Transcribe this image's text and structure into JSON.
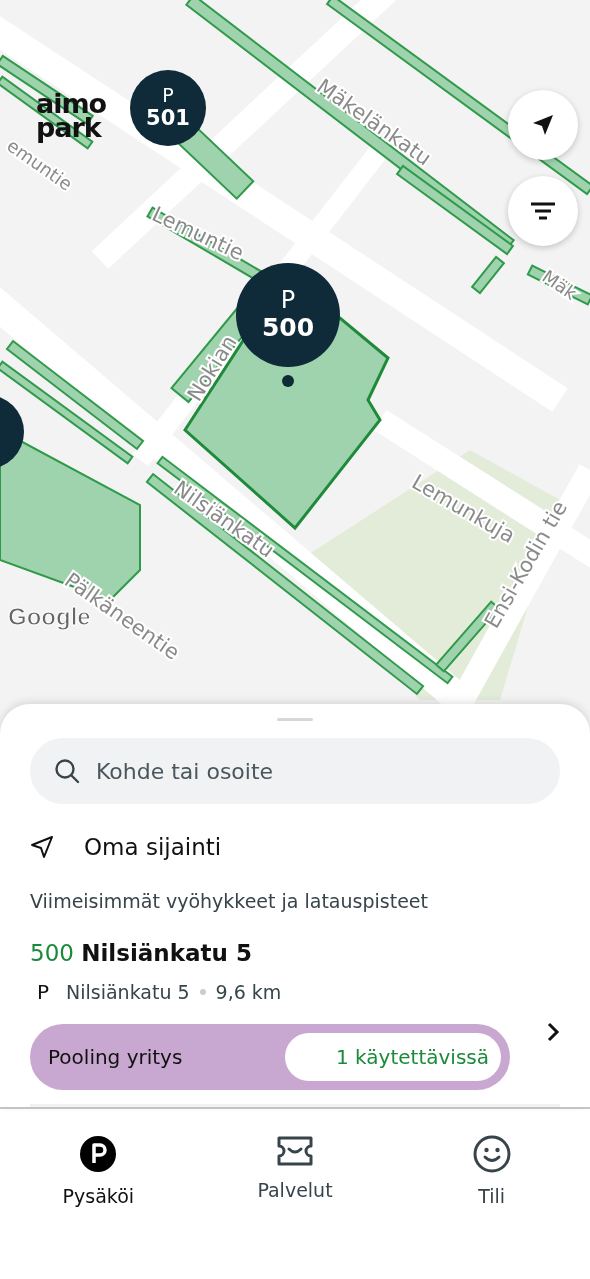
{
  "map": {
    "logo": {
      "line1": "aimo",
      "line2": "park"
    },
    "markers": [
      {
        "letter": "P",
        "number": "501"
      },
      {
        "letter": "P",
        "number": "500"
      }
    ],
    "street_labels": [
      "Mäkelänkatu",
      "Lemuntie",
      "emuntie",
      "Nokian",
      "Nilsiänkatu",
      "Lemunkuja",
      "Ensi-Kodin tie",
      "Pälkäneentie",
      "Mäk"
    ],
    "attribution": "Google"
  },
  "search": {
    "placeholder": "Kohde tai osoite"
  },
  "current_location": "Oma sijainti",
  "recent_heading": "Viimeisimmät vyöhykkeet ja latauspisteet",
  "recent": [
    {
      "zone": "500",
      "name": "Nilsiänkatu 5",
      "type": "P",
      "address": "Nilsiänkatu 5",
      "distance": "9,6 km",
      "pool_label": "Pooling yritys",
      "availability": "1 käytettävissä"
    }
  ],
  "nav": [
    {
      "kind": "park",
      "label": "Pysäköi",
      "selected": true
    },
    {
      "kind": "services",
      "label": "Palvelut",
      "selected": false
    },
    {
      "kind": "account",
      "label": "Tili",
      "selected": false
    }
  ]
}
